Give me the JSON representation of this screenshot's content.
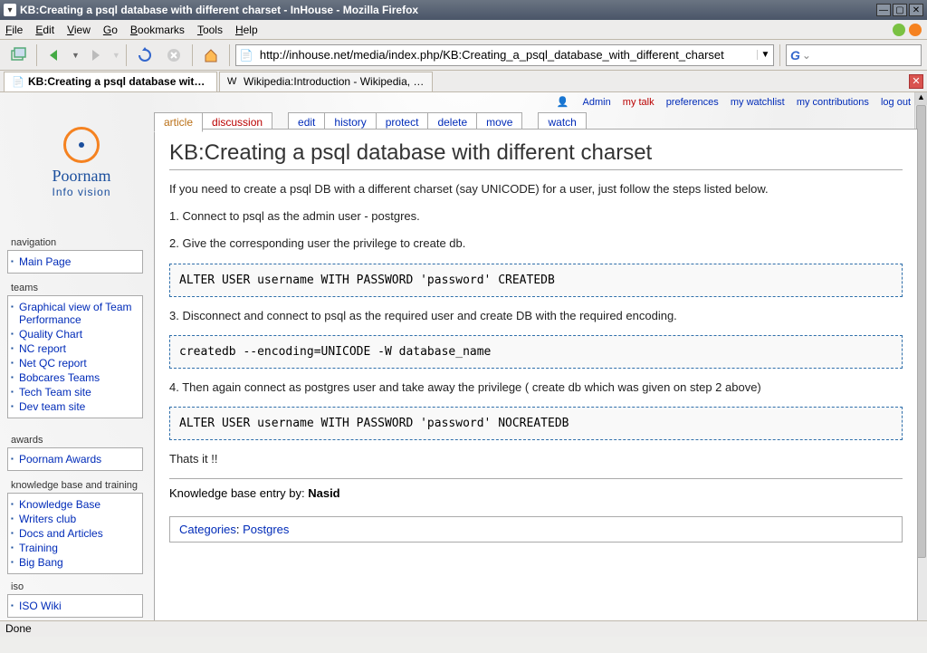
{
  "window": {
    "title": "KB:Creating a psql database with different charset - InHouse - Mozilla Firefox"
  },
  "menubar": {
    "file": "File",
    "edit": "Edit",
    "view": "View",
    "go": "Go",
    "bookmarks": "Bookmarks",
    "tools": "Tools",
    "help": "Help"
  },
  "toolbar": {
    "url": "http://inhouse.net/media/index.php/KB:Creating_a_psql_database_with_different_charset",
    "search_placeholder": ""
  },
  "browser_tabs": [
    {
      "label": "KB:Creating a psql database with...",
      "active": true
    },
    {
      "label": "Wikipedia:Introduction - Wikipedia, t...",
      "active": false
    }
  ],
  "personal": {
    "user": "Admin",
    "mytalk": "my talk",
    "prefs": "preferences",
    "watchlist": "my watchlist",
    "contribs": "my contributions",
    "logout": "log out"
  },
  "ca_tabs": {
    "article": "article",
    "discussion": "discussion",
    "edit": "edit",
    "history": "history",
    "protect": "protect",
    "delete": "delete",
    "move": "move",
    "watch": "watch"
  },
  "article": {
    "title": "KB:Creating a psql database with different charset",
    "intro": "If you need to create a psql DB with a different charset (say UNICODE) for a user, just follow the steps listed below.",
    "step1": "1. Connect to psql as the admin user - postgres.",
    "step2": "2. Give the corresponding user the privilege to create db.",
    "code1": "ALTER USER username WITH PASSWORD 'password' CREATEDB",
    "step3": "3. Disconnect and connect to psql as the required user and create DB with the required encoding.",
    "code2": "createdb --encoding=UNICODE -W database_name",
    "step4": "4. Then again connect as postgres user and take away the privilege ( create db which was given on step 2 above)",
    "code3": "ALTER USER username WITH PASSWORD 'password' NOCREATEDB",
    "thatsit": "Thats it !!",
    "sig_prefix": "Knowledge base entry by: ",
    "sig_author": "Nasid",
    "cat_label": "Categories",
    "cat_value": "Postgres"
  },
  "logo": {
    "brand": "Poornam",
    "tag": "Info vision"
  },
  "sidebar": {
    "navigation": {
      "title": "navigation",
      "items": [
        "Main Page"
      ]
    },
    "teams": {
      "title": "teams",
      "items": [
        "Graphical view of Team Performance",
        "Quality Chart",
        "NC report",
        "Net QC report",
        "Bobcares Teams",
        "Tech Team site",
        "Dev team site"
      ]
    },
    "awards": {
      "title": "awards",
      "items": [
        "Poornam Awards"
      ]
    },
    "kb": {
      "title": "knowledge base and training",
      "items": [
        "Knowledge Base",
        "Writers club",
        "Docs and Articles",
        "Training",
        "Big Bang"
      ]
    },
    "iso": {
      "title": "iso",
      "items": [
        "ISO Wiki"
      ]
    }
  },
  "statusbar": {
    "text": "Done"
  }
}
